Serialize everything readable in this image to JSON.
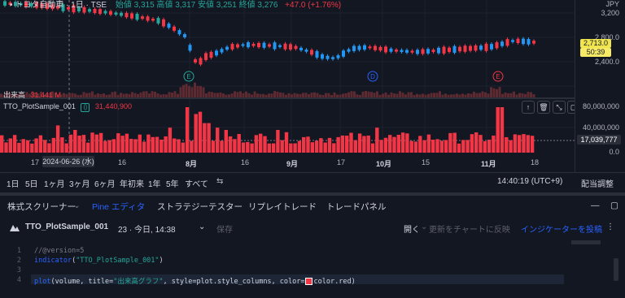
{
  "header": {
    "symbol_line": "• トヨタ自動車 · 1日 · TSE",
    "ohlc": "始値 3,315  高値 3,317  安値 3,251  終値 3,276",
    "change": "+47.0 (+1.76%)"
  },
  "price_axis": {
    "currency": "JPY",
    "ticks": [
      "3,200",
      "2,800.0",
      "2,400.0"
    ],
    "price_tag": "2,713.0",
    "time_tag": "50:39"
  },
  "volume_pane": {
    "label": "出来高",
    "value": "31.441 M"
  },
  "indicator_pane": {
    "name": "TTO_PlotSample_001",
    "value": "31,440,900",
    "axis_ticks": [
      "80,000,000",
      "40,000,000",
      "0.0"
    ],
    "last_value_tag": "17,039,777"
  },
  "markers": [
    {
      "letter": "E",
      "color": "#26a69a"
    },
    {
      "letter": "D",
      "color": "#2962ff"
    },
    {
      "letter": "E",
      "color": "#f23645"
    }
  ],
  "x_axis": {
    "labels": [
      "17",
      "16",
      "8月",
      "16",
      "9月",
      "17",
      "10月",
      "15",
      "11月",
      "18"
    ],
    "cursor_date": "2024-06-26 (水)"
  },
  "range_bar": {
    "ranges": [
      "1日",
      "5日",
      "1ヶ月",
      "3ヶ月",
      "6ヶ月",
      "年初来",
      "1年",
      "5年",
      "すべて"
    ],
    "time": "14:40:19 (UTC+9)",
    "adjust": "配当調整"
  },
  "panel_tabs": [
    "株式スクリーナー",
    "Pine エディタ",
    "ストラテジーテスター",
    "リプレイトレード",
    "トレードパネル"
  ],
  "editor": {
    "script_name": "TTO_PlotSample_001",
    "version_info": "23 · 今日, 14:38",
    "save": "保存",
    "open": "開く",
    "update_chart": "更新をチャートに反映",
    "publish": "インジケーターを投稿"
  },
  "code": {
    "line_numbers": [
      "1",
      "2",
      "3",
      "4"
    ],
    "line1": "//@version=5",
    "line2_fn": "indicator",
    "line2_arg": "\"TTO_PlotSample_001\"",
    "line4_a": "plot",
    "line4_b": "(volume, title=",
    "line4_c": "\"出来高グラフ\"",
    "line4_d": ", style=plot.style_columns, color=",
    "line4_e": "color.red",
    "line4_f": ")"
  },
  "colors": {
    "background": "#131722",
    "up": "#26a69a",
    "down": "#f23645",
    "accent": "#2962ff",
    "candle_blue": "#2196f3"
  }
}
